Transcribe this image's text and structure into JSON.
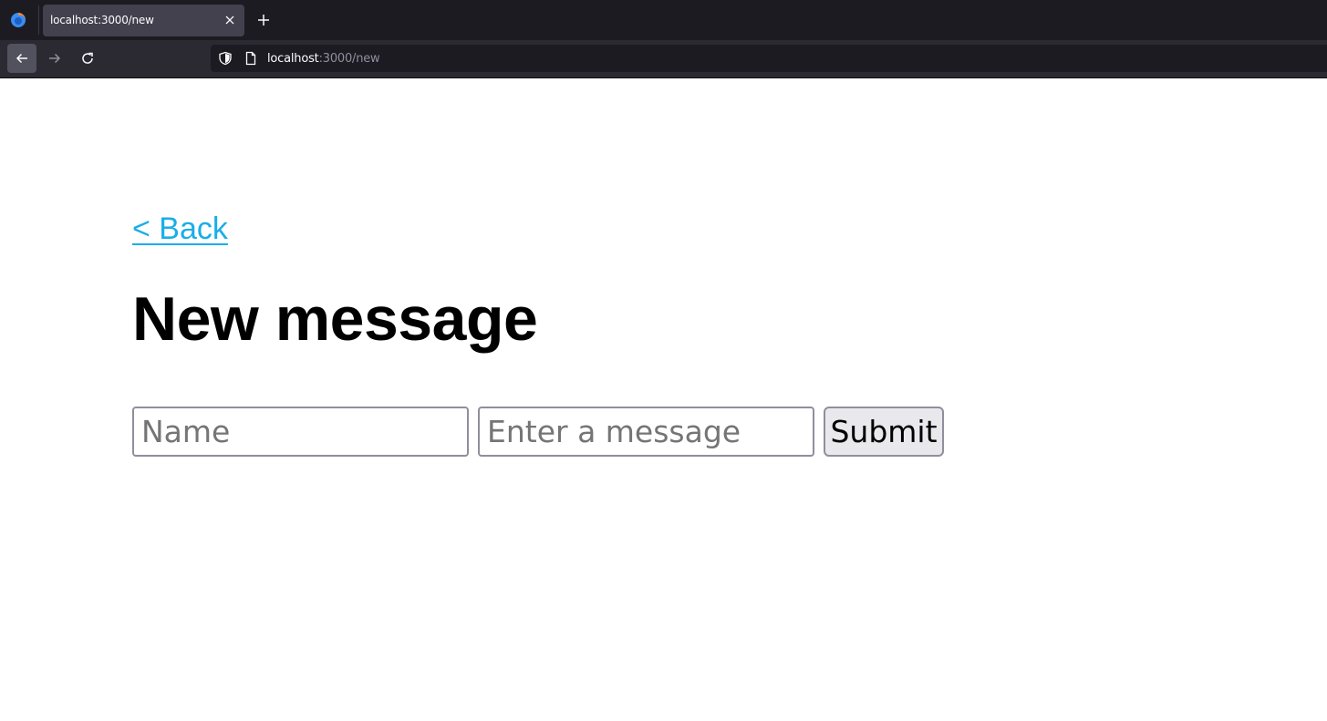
{
  "browser": {
    "tab": {
      "title": "localhost:3000/new",
      "close_icon": "close-icon"
    },
    "new_tab_icon": "plus-icon",
    "logo_icon": "firefox-logo-icon",
    "nav": {
      "back_icon": "arrow-left-icon",
      "forward_icon": "arrow-right-icon",
      "reload_icon": "reload-icon"
    },
    "url": {
      "host": "localhost",
      "path": ":3000/new",
      "shield_icon": "shield-icon",
      "page_icon": "page-icon"
    }
  },
  "page": {
    "back_link": "< Back",
    "title": "New message",
    "form": {
      "name_placeholder": "Name",
      "name_value": "",
      "message_placeholder": "Enter a message",
      "message_value": "",
      "submit_label": "Submit"
    }
  },
  "colors": {
    "link": "#1aaee8",
    "chrome_dark": "#1c1b22",
    "chrome_toolbar": "#2b2a33",
    "button_bg": "#e9e9ed",
    "input_border": "#8f8f9d"
  }
}
